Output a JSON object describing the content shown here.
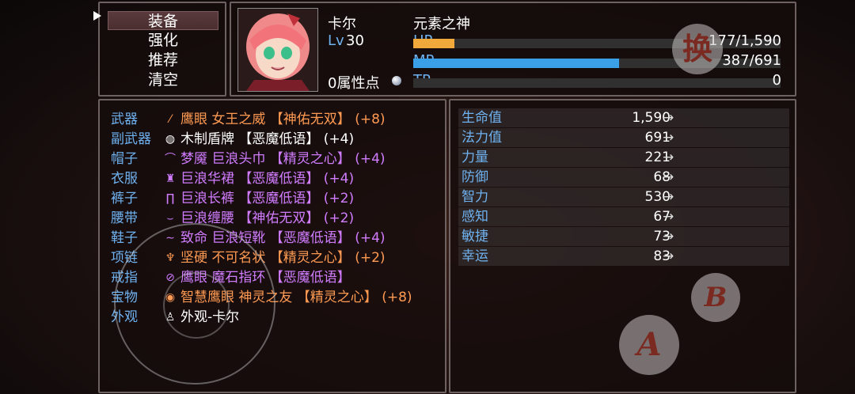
{
  "commands": [
    "装备",
    "强化",
    "推荐",
    "清空"
  ],
  "actor": {
    "name": "卡尔",
    "title": "元素之神",
    "level_label": "Lv",
    "level": "30",
    "attr_points": "0属性点",
    "hp_label": "HP",
    "hp_value": "177/1,590",
    "hp_ratio": 0.111,
    "mp_label": "MP",
    "mp_value": "387/691",
    "mp_ratio": 0.56,
    "tp_label": "TP",
    "tp_value": "0",
    "tp_ratio": 0,
    "hp_color": "#f2a93b",
    "mp_color": "#3aa0e8"
  },
  "equipment": [
    {
      "slot": "武器",
      "icon": "staff-icon",
      "glyph": "⁄",
      "item": "鹰眼 女王之威 【神佑无双】 (+8)",
      "color": "orange"
    },
    {
      "slot": "副武器",
      "icon": "shield-icon",
      "glyph": "◍",
      "item": "木制盾牌 【恶魔低语】 (+4)",
      "color": "white"
    },
    {
      "slot": "帽子",
      "icon": "hat-icon",
      "glyph": "⌒",
      "item": "梦魇 巨浪头巾 【精灵之心】 (+4)",
      "color": "purple"
    },
    {
      "slot": "衣服",
      "icon": "robe-icon",
      "glyph": "♜",
      "item": "巨浪华裙 【恶魔低语】 (+4)",
      "color": "purple"
    },
    {
      "slot": "裤子",
      "icon": "pants-icon",
      "glyph": "∏",
      "item": "巨浪长裤 【恶魔低语】 (+2)",
      "color": "purple"
    },
    {
      "slot": "腰带",
      "icon": "belt-icon",
      "glyph": "⌣",
      "item": "巨浪缠腰 【神佑无双】 (+2)",
      "color": "purple"
    },
    {
      "slot": "鞋子",
      "icon": "boots-icon",
      "glyph": "∼",
      "item": "致命 巨浪短靴 【恶魔低语】 (+4)",
      "color": "purple"
    },
    {
      "slot": "项链",
      "icon": "necklace-icon",
      "glyph": "♆",
      "item": "坚硬 不可名状 【精灵之心】 (+2)",
      "color": "orange"
    },
    {
      "slot": "戒指",
      "icon": "ring-icon",
      "glyph": "⊘",
      "item": "鹰眼 魔石指环 【恶魔低语】",
      "color": "purple"
    },
    {
      "slot": "宝物",
      "icon": "treasure-icon",
      "glyph": "◉",
      "item": "智慧鹰眼 神灵之友 【精灵之心】 (+8)",
      "color": "orange"
    },
    {
      "slot": "外观",
      "icon": "costume-icon",
      "glyph": "♙",
      "item": "外观-卡尔",
      "color": "white"
    }
  ],
  "params": [
    {
      "name": "生命值",
      "value": "1,590",
      "arrow": "→"
    },
    {
      "name": "法力值",
      "value": "691",
      "arrow": "→"
    },
    {
      "name": "力量",
      "value": "221",
      "arrow": "→"
    },
    {
      "name": "防御",
      "value": "68",
      "arrow": "→"
    },
    {
      "name": "智力",
      "value": "530",
      "arrow": "→"
    },
    {
      "name": "感知",
      "value": "67",
      "arrow": "→"
    },
    {
      "name": "敏捷",
      "value": "73",
      "arrow": "→"
    },
    {
      "name": "幸运",
      "value": "83",
      "arrow": "→"
    }
  ],
  "buttons": {
    "switch": "换",
    "a": "A",
    "b": "B"
  }
}
